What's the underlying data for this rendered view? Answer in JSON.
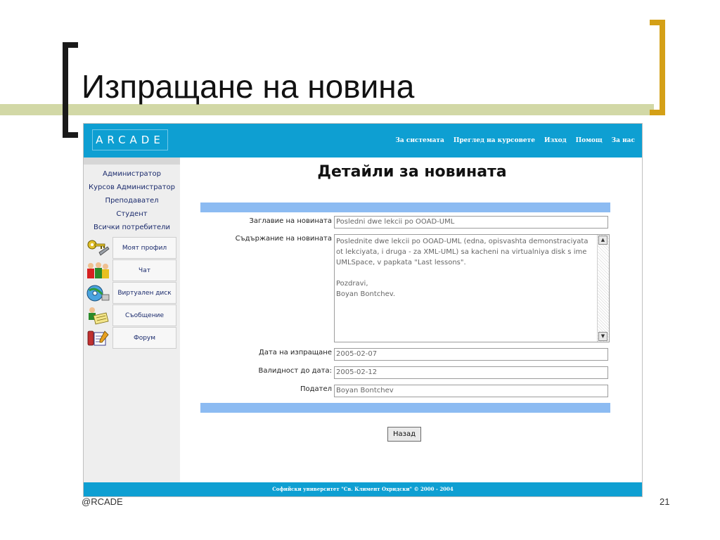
{
  "slide": {
    "title": "Изпращане на новина",
    "footer_left": "@RCADE",
    "page_number": "21"
  },
  "colors": {
    "app_bar": "#0e9fd2",
    "section_bar": "#8cbbf2",
    "olive_band": "#d2d8a6",
    "right_bracket": "#d4a017"
  },
  "app": {
    "logo": "ARCADE",
    "nav": [
      "За системата",
      "Преглед на курсовете",
      "Изход",
      "Помощ",
      "За нас"
    ],
    "footer": "Софийски университет \"Св. Климент Охридски\" © 2000 - 2004"
  },
  "sidebar": {
    "roles": [
      "Администратор",
      "Курсов Администратор",
      "Преподавател",
      "Студент",
      "Всички потребители"
    ],
    "menu": [
      {
        "label": "Моят профил",
        "icon": "keys-icon"
      },
      {
        "label": "Чат",
        "icon": "people-icon"
      },
      {
        "label": "Виртуален диск",
        "icon": "disk-icon"
      },
      {
        "label": "Съобщение",
        "icon": "message-icon"
      },
      {
        "label": "Форум",
        "icon": "forum-icon"
      }
    ]
  },
  "main": {
    "title": "Детайли за новината",
    "fields": {
      "title_label": "Заглавие на новината",
      "title_value": "Posledni dwe lekcii po OOAD-UML",
      "content_label": "Съдържание на новината",
      "content_value": "Poslednite dwe lekcii po OOAD-UML (edna, opisvashta demonstraciyata ot lekciyata, i druga - za XML-UML) sa kacheni na virtualniya disk s ime UMLSpace, v papkata \"Last lessons\".\n\nPozdravi,\nBoyan Bontchev.",
      "date_label": "Дата на изпращане",
      "date_value": "2005-02-07",
      "valid_label": "Валидност до дата:",
      "valid_value": "2005-02-12",
      "sender_label": "Подател",
      "sender_value": "Boyan Bontchev"
    },
    "back_button": "Назад"
  }
}
